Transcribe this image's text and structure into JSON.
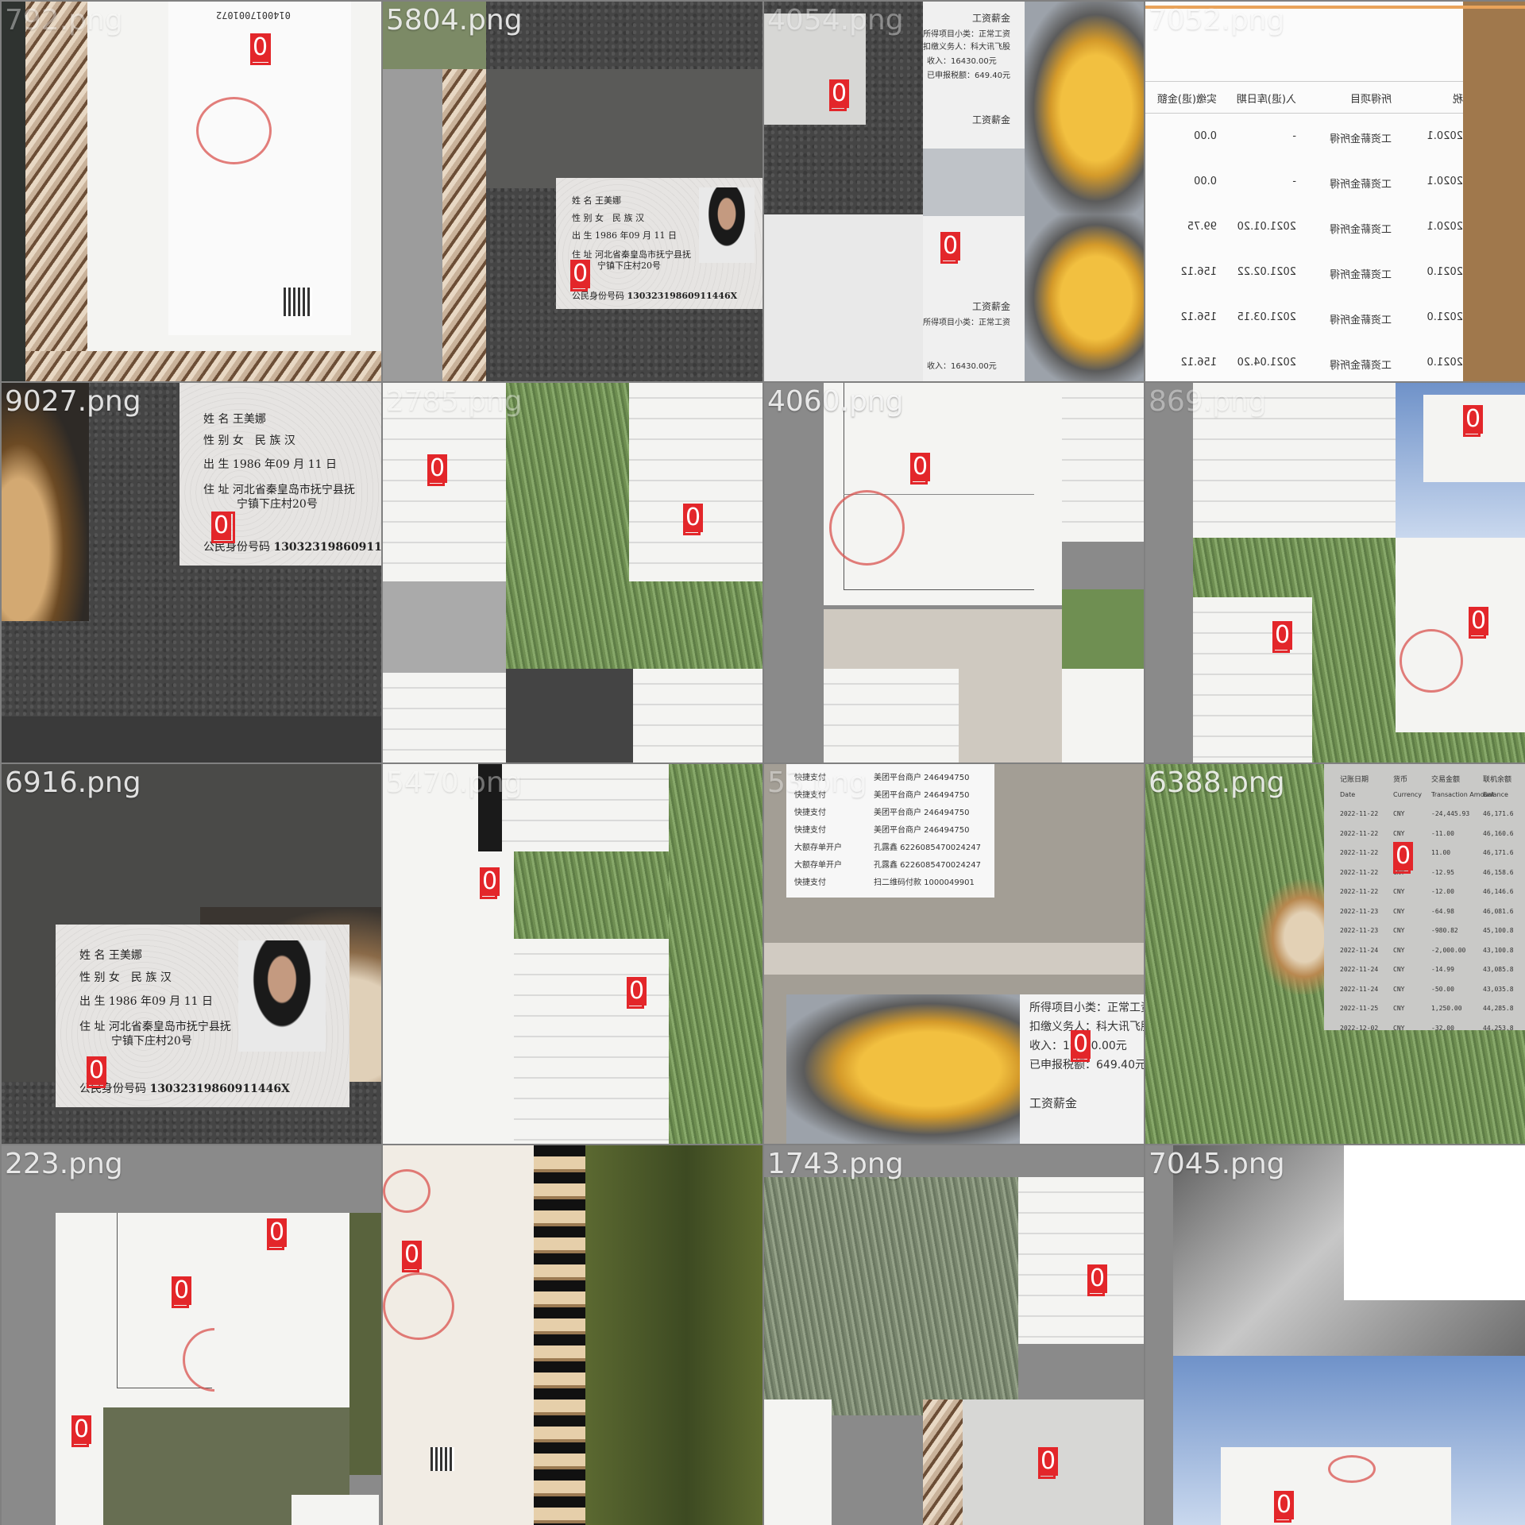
{
  "tiles": [
    {
      "file": "792.png",
      "tag": "0"
    },
    {
      "file": "5804.png",
      "tag": "0"
    },
    {
      "file": "4054.png",
      "tag": "0"
    },
    {
      "file": "7052.png",
      "tag": "0"
    },
    {
      "file": "9027.png",
      "tag": "0"
    },
    {
      "file": "2785.png",
      "tag": "0"
    },
    {
      "file": "4060.png",
      "tag": "0"
    },
    {
      "file": "869.png",
      "tag": "0"
    },
    {
      "file": "6916.png",
      "tag": "0"
    },
    {
      "file": "5470.png",
      "tag": "0"
    },
    {
      "file": "53.png",
      "tag": "0"
    },
    {
      "file": "6388.png",
      "tag": "0"
    },
    {
      "file": "223.png",
      "tag": "0"
    },
    {
      "file": "",
      "tag": "0"
    },
    {
      "file": "1743.png",
      "tag": "0"
    },
    {
      "file": "7045.png",
      "tag": "0"
    }
  ],
  "id_card": {
    "name_label": "姓 名",
    "name": "王美娜",
    "sex_label": "性 别",
    "sex": "女",
    "ethnic_label": "民 族",
    "ethnic": "汉",
    "birth_label": "出 生",
    "birth": "1986 年09 月 11 日",
    "addr_label": "住 址",
    "addr1": "河北省秦皇岛市抚宁县抚",
    "addr2": "宁镇下庄村20号",
    "idno_label": "公民身份号码",
    "idno": "13032319860911446X"
  },
  "tax": {
    "title": "工资薪金",
    "line1": "所得项目小类：正常工资",
    "line2": "扣缴义务人：科大讯飞股",
    "line3": "收入：16430.00元",
    "line4": "已申报税额：649.40元"
  },
  "pay": {
    "rows": [
      [
        "快捷支付",
        "美团平台商户 246494750"
      ],
      [
        "快捷支付",
        "美团平台商户 246494750"
      ],
      [
        "快捷支付",
        "美团平台商户 246494750"
      ],
      [
        "快捷支付",
        "美团平台商户 246494750"
      ],
      [
        "大额存单开户",
        "孔露鑫 6226085470024247"
      ],
      [
        "大额存单开户",
        "孔露鑫 6226085470024247"
      ],
      [
        "快捷支付",
        "扫二维码付款 1000049901"
      ]
    ]
  },
  "ledger": {
    "headers": [
      "记账日期",
      "货币",
      "交易金额",
      "联机余额"
    ],
    "headers_en": [
      "Date",
      "Currency",
      "Transaction Amount",
      "Balance"
    ],
    "rows": [
      [
        "2022-11-22",
        "CNY",
        "-24,445.93",
        "46,171.6"
      ],
      [
        "2022-11-22",
        "CNY",
        "-11.00",
        "46,160.6"
      ],
      [
        "2022-11-22",
        "CNY",
        "11.00",
        "46,171.6"
      ],
      [
        "2022-11-22",
        "CNY",
        "-12.95",
        "46,158.6"
      ],
      [
        "2022-11-22",
        "CNY",
        "-12.00",
        "46,146.6"
      ],
      [
        "2022-11-23",
        "CNY",
        "-64.98",
        "46,081.6"
      ],
      [
        "2022-11-23",
        "CNY",
        "-980.82",
        "45,100.8"
      ],
      [
        "2022-11-24",
        "CNY",
        "-2,000.00",
        "43,100.8"
      ],
      [
        "2022-11-24",
        "CNY",
        "-14.99",
        "43,085.8"
      ],
      [
        "2022-11-24",
        "CNY",
        "-50.00",
        "43,035.8"
      ],
      [
        "2022-11-25",
        "CNY",
        "1,250.00",
        "44,285.8"
      ],
      [
        "2022-12-02",
        "CNY",
        "-32.00",
        "44,253.8"
      ]
    ]
  },
  "tax_table": {
    "headers": [
      "税",
      "所得项目",
      "入(退)库日期",
      "实缴(退)金额"
    ],
    "rows": [
      [
        "2020.1",
        "工资薪金所得",
        "-",
        "0.00"
      ],
      [
        "2020.1",
        "工资薪金所得",
        "-",
        "0.00"
      ],
      [
        "2020.1",
        "工资薪金所得",
        "2021.01.20",
        "99.75"
      ],
      [
        "2021.0",
        "工资薪金所得",
        "2021.02.22",
        "156.12"
      ],
      [
        "2021.0",
        "工资薪金所得",
        "2021.03.15",
        "156.12"
      ],
      [
        "2021.0",
        "工资薪金所得",
        "2021.04.20",
        "156.12"
      ]
    ]
  },
  "colors": {
    "box": "#e3262a",
    "tag_text": "#ffffff"
  }
}
